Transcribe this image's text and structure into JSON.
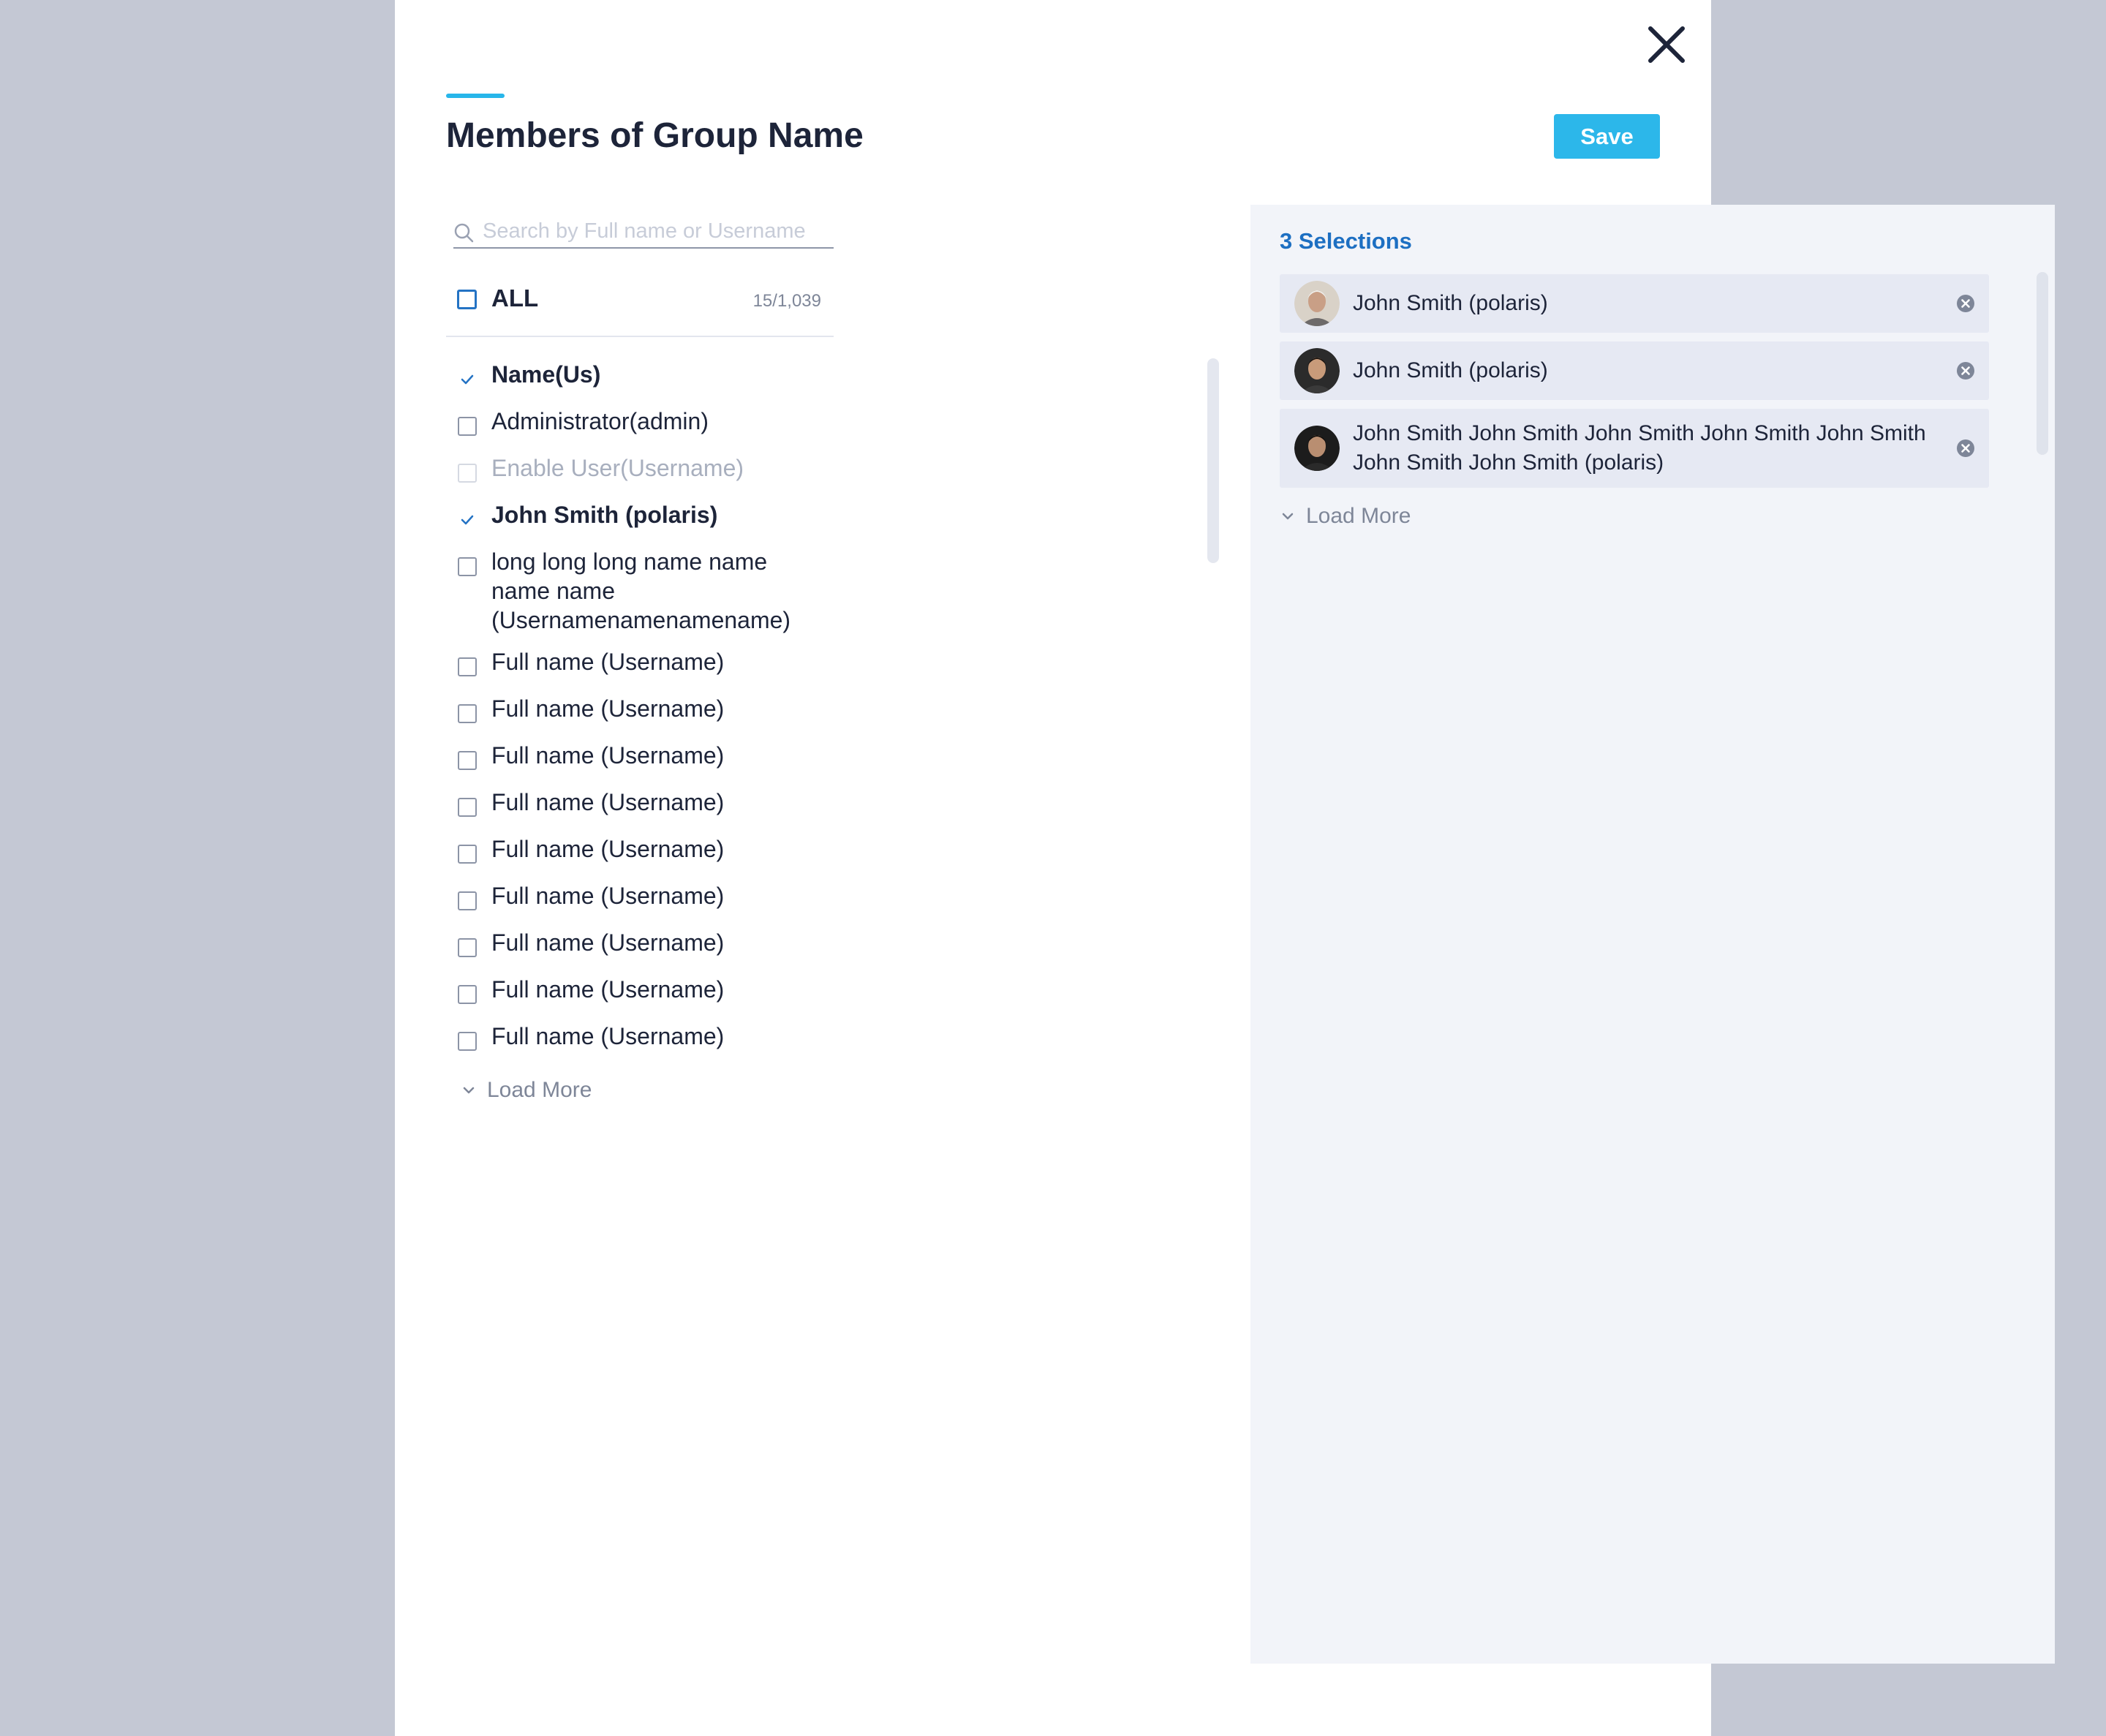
{
  "dialog": {
    "title": "Members of Group Name",
    "save_label": "Save",
    "colors": {
      "accent": "#27b6ea",
      "save": "#2cb7ea",
      "link": "#1d6fc2"
    }
  },
  "search": {
    "placeholder": "Search by Full name or Username",
    "value": ""
  },
  "all_option": {
    "label": "ALL",
    "count": "15/1,039"
  },
  "members": [
    {
      "label": "Name(Us)",
      "state": "checked"
    },
    {
      "label": "Administrator(admin)",
      "state": "unchecked"
    },
    {
      "label": "Enable User(Username)",
      "state": "disabled"
    },
    {
      "label": "John Smith (polaris)",
      "state": "checked"
    },
    {
      "label": "long long long name name name name (Usernamenamenamename)",
      "state": "unchecked"
    },
    {
      "label": "Full name (Username)",
      "state": "unchecked"
    },
    {
      "label": "Full name (Username)",
      "state": "unchecked"
    },
    {
      "label": "Full name (Username)",
      "state": "unchecked"
    },
    {
      "label": "Full name (Username)",
      "state": "unchecked"
    },
    {
      "label": "Full name (Username)",
      "state": "unchecked"
    },
    {
      "label": "Full name (Username)",
      "state": "unchecked"
    },
    {
      "label": "Full name (Username)",
      "state": "unchecked"
    },
    {
      "label": "Full name (Username)",
      "state": "unchecked"
    },
    {
      "label": "Full name (Username)",
      "state": "unchecked"
    }
  ],
  "left_load_more": "Load More",
  "selections": {
    "count_label": "3 Selections",
    "items": [
      {
        "name": "John Smith (polaris)",
        "avatar": "avatar-photo-1"
      },
      {
        "name": "John Smith (polaris)",
        "avatar": "avatar-photo-2"
      },
      {
        "name": "John Smith John Smith John Smith John Smith John Smith John Smith John Smith (polaris)",
        "avatar": "avatar-photo-3"
      }
    ],
    "load_more": "Load More"
  }
}
